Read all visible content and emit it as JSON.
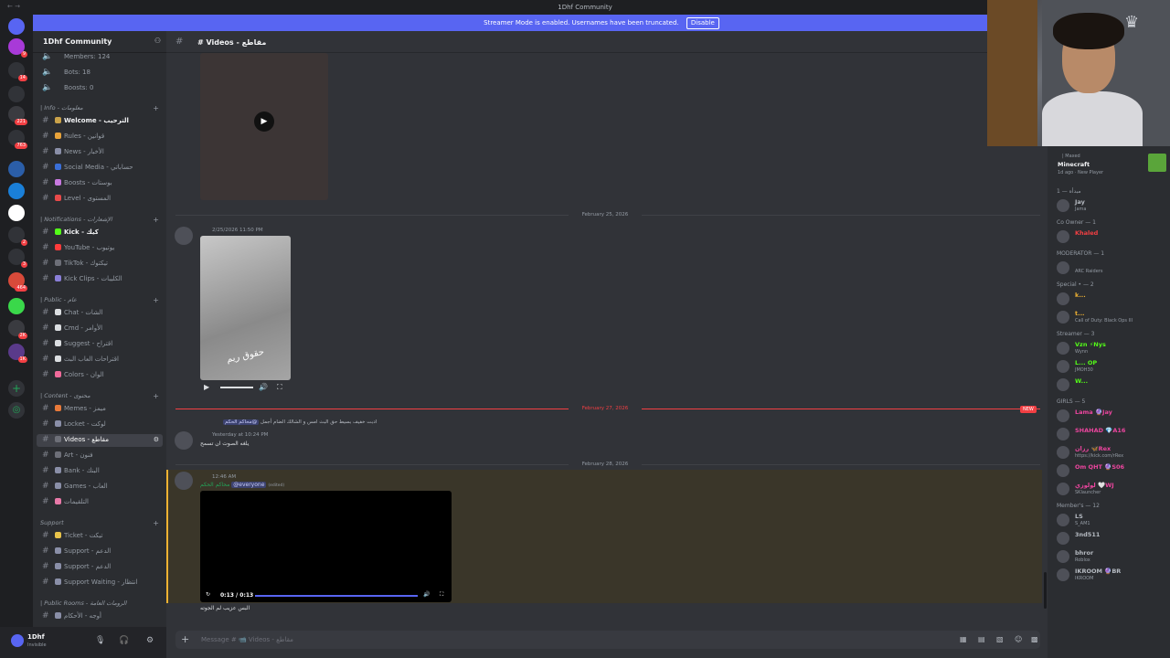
{
  "window": {
    "title": "1Dhf Community",
    "nav": "← →"
  },
  "banner": {
    "text": "Streamer Mode is enabled. Usernames have been truncated.",
    "button": "Disable"
  },
  "server_badges": [
    "9",
    "14",
    "221",
    "763",
    "2",
    "3",
    "464",
    "2K",
    "1K"
  ],
  "guild": {
    "name": "1Dhf Community"
  },
  "channels": {
    "stats": [
      {
        "name": "Members: 124"
      },
      {
        "name": "Bots: 18"
      },
      {
        "name": "Boosts: 0"
      }
    ],
    "info_category": "| Info - معلومات",
    "info": [
      {
        "name": "Welcome - الترحيب",
        "color": "#c9a24a",
        "bold": true
      },
      {
        "name": "Rules - قوانين",
        "color": "#e8a33a"
      },
      {
        "name": "News - الأخبار",
        "color": "#8a8fa8"
      },
      {
        "name": "Social Media - حساباتي",
        "color": "#3a6fd8"
      },
      {
        "name": "Boosts - بوستات",
        "color": "#c879e0"
      },
      {
        "name": "Level - المستوى",
        "color": "#e84a4a"
      }
    ],
    "notif_category": "| Notifications - الإشعارات",
    "notifications": [
      {
        "name": "Kick - كيك",
        "color": "#53fc18",
        "bold": true
      },
      {
        "name": "YouTube - يوتيوب",
        "color": "#ff3b3b"
      },
      {
        "name": "TikTok - تيكتوك",
        "color": "#6d6f78"
      },
      {
        "name": "Kick Clips - الكليبات",
        "color": "#8a7fd8"
      }
    ],
    "public_category": "| Public - عام",
    "public": [
      {
        "name": "Chat - الشات",
        "color": "#dbdee1"
      },
      {
        "name": "Cmd - الأوامر",
        "color": "#dbdee1"
      },
      {
        "name": "Suggest - اقتراح",
        "color": "#dbdee1"
      },
      {
        "name": "اقتراحات العاب البث",
        "color": "#dbdee1"
      },
      {
        "name": "Colors - الوان",
        "color": "#f06a9a"
      }
    ],
    "content_category": "| Content - محتوى",
    "content": [
      {
        "name": "Memes - ميمز",
        "color": "#e87a3a"
      },
      {
        "name": "Locket - لوكت",
        "color": "#8a8fa8"
      },
      {
        "name": "Videos - مقاطع",
        "color": "#6d6f78",
        "active": true
      },
      {
        "name": "Art - فنون",
        "color": "#6d6f78"
      },
      {
        "name": "Bank - البنك",
        "color": "#8a8fa8"
      },
      {
        "name": "Games - العاب",
        "color": "#8a8fa8"
      },
      {
        "name": "التلقيمات",
        "color": "#e879a8"
      }
    ],
    "support_category": "Support",
    "support": [
      {
        "name": "Ticket - تيكت",
        "color": "#e8c34a"
      },
      {
        "name": "Support - الدعم",
        "color": "#8a8fa8"
      },
      {
        "name": "Support - الدعم",
        "color": "#8a8fa8"
      },
      {
        "name": "Support Waiting - انتظار",
        "color": "#8a8fa8"
      }
    ],
    "rooms_category": "| Public Rooms - الرومات العامة",
    "rooms": [
      {
        "name": "أوجه - الأحكام",
        "color": "#8a8fa8"
      }
    ]
  },
  "user": {
    "name": "1Dhf",
    "status": "Invisible"
  },
  "chat": {
    "channel_title": "# Videos - مقاطع",
    "date1": "February 25, 2026",
    "msg1_time": "2/25/2026 11:50 PM",
    "msg1_caption": "حقوق ريم",
    "date2": "February 27, 2026",
    "new_label": "NEW",
    "msg2_reply": "ادبت خفيف بسيط حق البث امس و الشالك الضام أجمل",
    "msg2_mention": "@محاكم الحكم",
    "msg2_time": "Yesterday at 10:24 PM",
    "msg2_text": "يلغه الصوت ان تسمح",
    "date3": "February 28, 2026",
    "msg3_time": "12:46 AM",
    "msg3_mention": "@everyone",
    "msg3_edited": "(edited)",
    "msg3_author": "محاكم الحكم",
    "msg3_video_time": "0:13 / 0:13",
    "msg3_text": "البس عزيب لم الجوته",
    "composer_placeholder": "Message # 📹 Videos - مقاطع"
  },
  "members": {
    "activity_label": "| Maxed",
    "game": "Minecraft",
    "game_sub": "1d ago",
    "game_status": "New Player",
    "sections": [
      {
        "label": "مبدأه — 1",
        "items": [
          {
            "name": "Jay",
            "sub": "Jama",
            "color": "#b5bac1"
          }
        ]
      },
      {
        "label": "Co Owner — 1",
        "items": [
          {
            "name": "Khaled",
            "sub": "",
            "color": "#f23f43"
          }
        ]
      },
      {
        "label": "MODERATOR — 1",
        "items": [
          {
            "name": "",
            "sub": "ARC Raiders",
            "color": "#b5bac1"
          }
        ]
      },
      {
        "label": "Special • — 2",
        "items": [
          {
            "name": "k...",
            "sub": "",
            "color": "#f0b232"
          },
          {
            "name": "t...",
            "sub": "Call of Duty: Black Ops III",
            "color": "#f0b232"
          }
        ]
      },
      {
        "label": "Streamer — 3",
        "items": [
          {
            "name": "Vzn ⚡Nys",
            "sub": "Wynn",
            "color": "#53fc18"
          },
          {
            "name": "L... OP",
            "sub": "JMOH30",
            "color": "#53fc18"
          },
          {
            "name": "W...",
            "sub": "",
            "color": "#53fc18"
          }
        ]
      },
      {
        "label": "GIRLS — 5",
        "items": [
          {
            "name": "Lama 🔮Jay",
            "sub": "",
            "color": "#eb459e"
          },
          {
            "name": "SHAHAD 💎A16",
            "sub": "",
            "color": "#eb459e"
          },
          {
            "name": "رزان 🦋Rex",
            "sub": "https://kick.com/rRex",
            "color": "#eb459e"
          },
          {
            "name": "Om QHT 🔮S06",
            "sub": "",
            "color": "#eb459e"
          },
          {
            "name": "لولوزي 🤍WJ",
            "sub": "SKlauncher",
            "color": "#eb459e"
          }
        ]
      },
      {
        "label": "Member's — 12",
        "items": [
          {
            "name": "LS",
            "sub": "S_AM1",
            "color": "#b5bac1"
          },
          {
            "name": "3nd511",
            "sub": "",
            "color": "#b5bac1"
          },
          {
            "name": "bhror",
            "sub": "Roblox",
            "color": "#b5bac1"
          },
          {
            "name": "IKROOM 🔮BR",
            "sub": "IKROOM",
            "color": "#b5bac1"
          }
        ]
      }
    ]
  }
}
